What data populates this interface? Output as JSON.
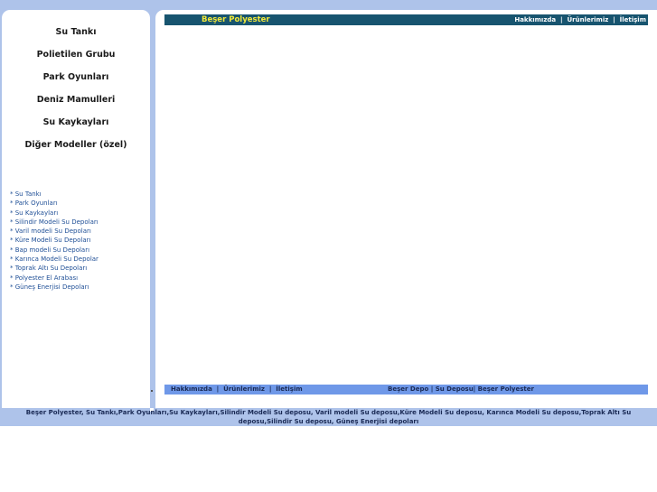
{
  "sidebar": {
    "menu": [
      "Su Tankı",
      "Polietilen Grubu",
      "Park Oyunları",
      "Deniz Mamulleri",
      "Su Kaykayları",
      "Diğer Modeller (özel)"
    ],
    "links": [
      "* Su Tankı",
      "* Park Oyunları",
      "* Su Kaykayları",
      "* Silindir Modeli Su Depoları",
      "* Varil modeli  Su Depoları",
      "* Küre Modeli  Su Depoları",
      "* Bap modeli  Su Depoları",
      "* Karınca Modeli  Su Depolar",
      "* Toprak Altı  Su Depoları",
      "* Polyester El Arabası",
      "* Güneş Enerjisi Depoları"
    ]
  },
  "header": {
    "brand": "Beşer Polyester",
    "nav": [
      "Hakkımızda",
      "Ürünlerimiz",
      "İletişim"
    ],
    "separator": "|"
  },
  "bottom_bar": {
    "nav": [
      "Hakkımızda",
      "Ürünlerimiz",
      "İletişim"
    ],
    "credit": "Beşer Depo | Su Deposu| Beşer Polyester"
  },
  "footer": {
    "keywords": "Beşer Polyester, Su Tankı,Park Oyunları,Su Kaykayları,Silindir Modeli Su deposu, Varil modeli Su deposu,Küre Modeli Su deposu, Karınca Modeli Su deposu,Toprak Altı Su deposu,Silindir Su deposu, Güneş Enerjisi depoları"
  },
  "colors": {
    "frame": "#aec3ea",
    "header_bar": "#17546f",
    "brand_text": "#f2e93a",
    "bottom_bar": "#6f98e8",
    "link": "#1f4f96"
  }
}
